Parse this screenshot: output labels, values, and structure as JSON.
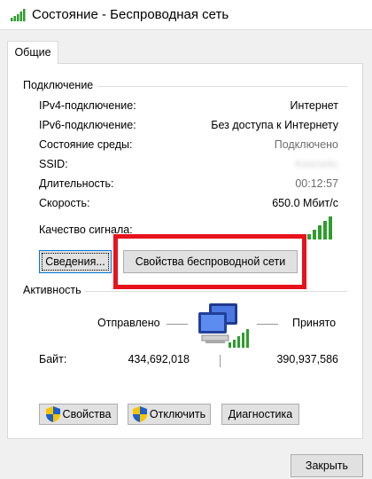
{
  "window": {
    "title": "Состояние - Беспроводная сеть",
    "icon": "wifi-signal-icon"
  },
  "tabs": [
    {
      "label": "Общие",
      "selected": true
    }
  ],
  "connection": {
    "title": "Подключение",
    "rows": [
      {
        "label": "IPv4-подключение:",
        "value": "Интернет"
      },
      {
        "label": "IPv6-подключение:",
        "value": "Без доступа к Интернету"
      },
      {
        "label": "Состояние среды:",
        "value": "Подключено"
      },
      {
        "label": "SSID:",
        "value": "Keenetic"
      },
      {
        "label": "Длительность:",
        "value": "00:12:57"
      },
      {
        "label": "Скорость:",
        "value": "650.0 Мбит/с"
      }
    ],
    "signal_label": "Качество сигнала:",
    "signal_bars": 5,
    "details_button": "Сведения...",
    "wireless_props_button": "Свойства беспроводной сети"
  },
  "activity": {
    "title": "Активность",
    "sent_label": "Отправлено",
    "received_label": "Принято",
    "bytes_label": "Байт:",
    "sent_bytes": "434,692,018",
    "received_bytes": "390,937,586"
  },
  "buttons": {
    "properties": "Свойства",
    "disable": "Отключить",
    "diagnose": "Диагностика",
    "close": "Закрыть"
  },
  "colors": {
    "highlight": "#e8121c",
    "signal": "#2e9e2e",
    "focus": "#0078d7"
  }
}
